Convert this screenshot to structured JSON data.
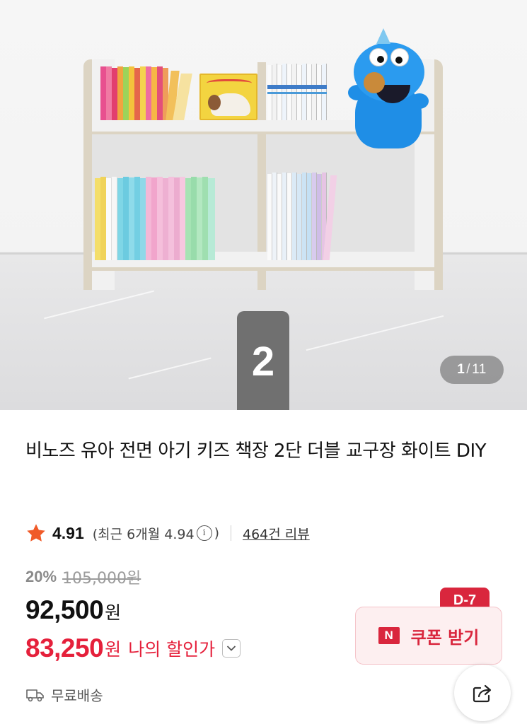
{
  "gallery": {
    "current_page": "1",
    "separator": "/",
    "total_pages": "11",
    "badge_number": "2"
  },
  "product": {
    "title": "비노즈 유아 전면 아기 키즈 책장 2단 더블 교구장 화이트 DIY",
    "rating": "4.91",
    "recent_open": "(최근 6개월 4.94",
    "recent_close": ")",
    "review_count_label": "464건 리뷰",
    "discount_rate": "20%",
    "original_price": "105,000원",
    "price": "92,500",
    "price_unit": "원",
    "my_price": "83,250",
    "my_price_unit": "원",
    "my_price_label": "나의 할인가",
    "shipping": "무료배송"
  },
  "coupon": {
    "label": "쿠폰 받기",
    "brand_mark": "N",
    "dday": "D-7"
  },
  "icons": {
    "rating": "star-icon",
    "info": "info-icon",
    "expand": "chevron-down-icon",
    "shipping": "truck-icon",
    "share": "share-icon",
    "info_glyph": "i"
  },
  "colors": {
    "accent_red": "#e5203b",
    "coupon_red": "#d9263d",
    "star": "#f05a28"
  }
}
